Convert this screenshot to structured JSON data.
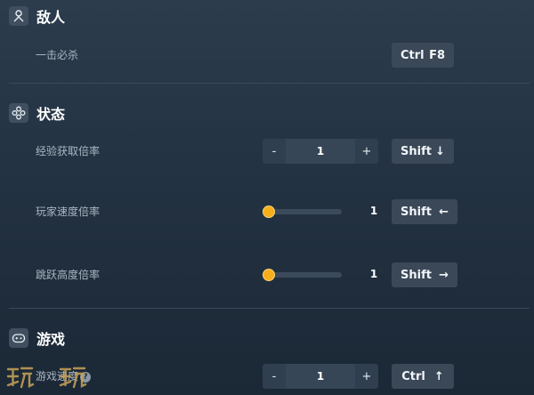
{
  "sections": {
    "enemy": {
      "title": "敌人",
      "icon": "person-icon",
      "rows": [
        {
          "label": "一击必杀",
          "hotkey": [
            "Ctrl",
            "F8"
          ]
        }
      ]
    },
    "status": {
      "title": "状态",
      "icon": "dpad-icon",
      "rows": [
        {
          "label": "经验获取倍率",
          "control": "stepper",
          "minus": "-",
          "value": "1",
          "plus": "+",
          "hotkey": [
            "Shift",
            "↓"
          ]
        },
        {
          "label": "玩家速度倍率",
          "control": "slider",
          "value": "1",
          "level": 0,
          "hotkey": [
            "Shift",
            "←"
          ]
        },
        {
          "label": "跳跃高度倍率",
          "control": "slider",
          "value": "1",
          "level": 0,
          "hotkey": [
            "Shift",
            "→"
          ]
        }
      ]
    },
    "game": {
      "title": "游戏",
      "icon": "gamepad-icon",
      "rows": [
        {
          "label": "游戏速度",
          "help": "?",
          "control": "stepper",
          "minus": "-",
          "value": "1",
          "plus": "+",
          "hotkey": [
            "Ctrl",
            "↑"
          ]
        }
      ]
    }
  },
  "colors": {
    "accent": "#f6ae1a",
    "background": "#233242",
    "panel": "#3a4858"
  },
  "watermark": {
    "icon": "site-logo-watermark"
  }
}
